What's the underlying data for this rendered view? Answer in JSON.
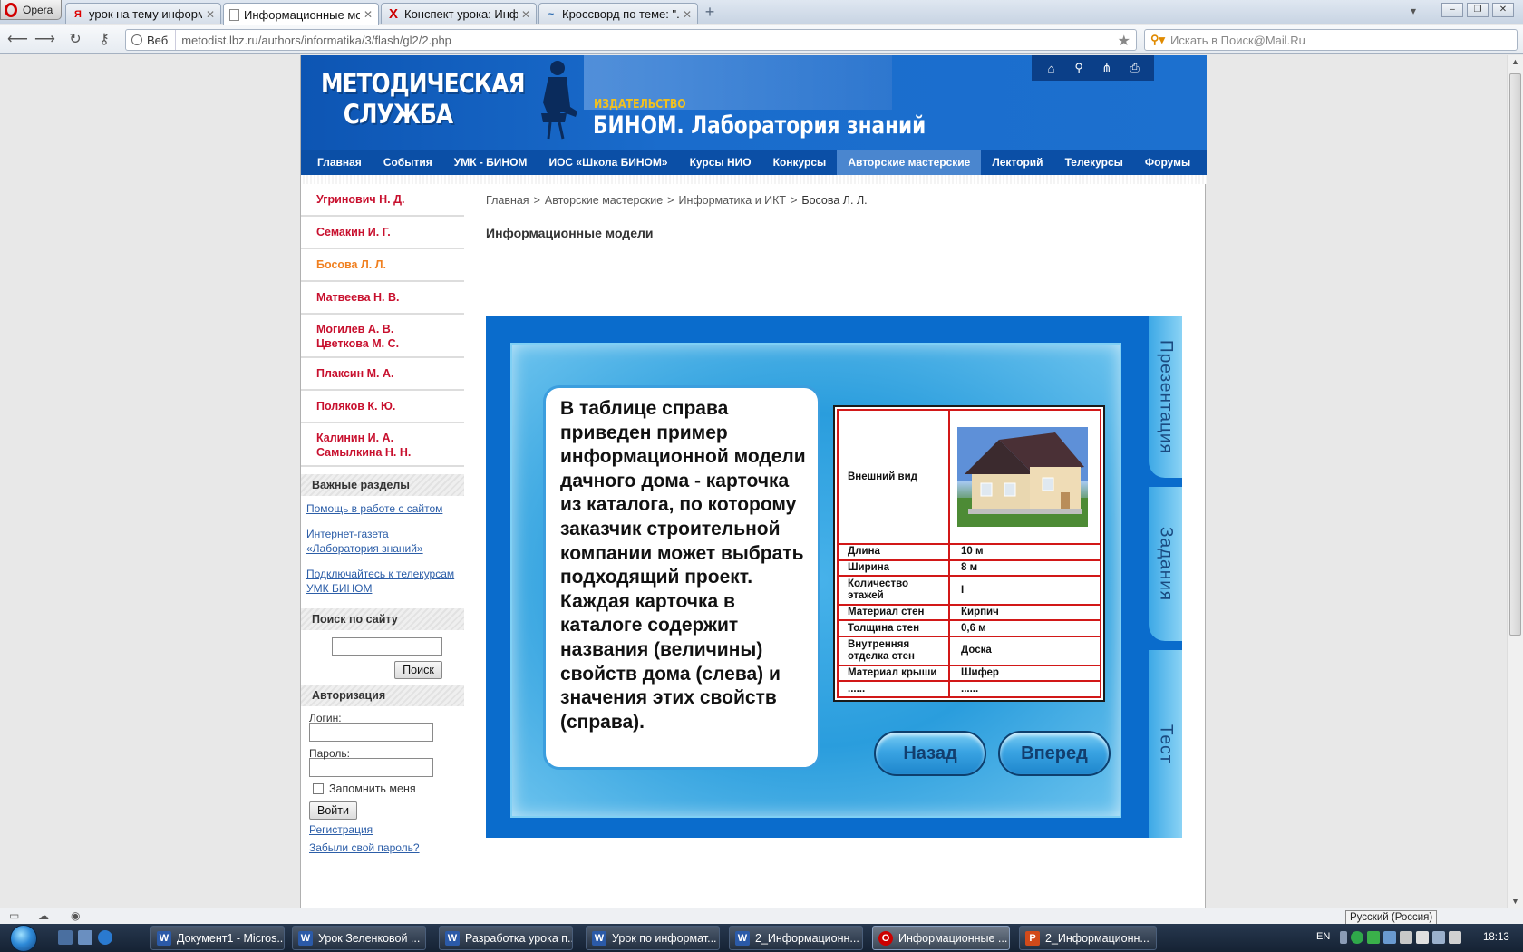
{
  "browser": {
    "menu_label": "Opera",
    "tabs": [
      {
        "label": "урок на тему информ...",
        "icon": "yandex-icon"
      },
      {
        "label": "Информационные мо...",
        "icon": "page-icon"
      },
      {
        "label": "Конспект урока: Инф...",
        "icon": "x-site-icon"
      },
      {
        "label": "Кроссворд по теме: \"...",
        "icon": "crossword-icon"
      }
    ],
    "url_prefix": "Веб",
    "url": "metodist.lbz.ru/authors/informatika/3/flash/gl2/2.php",
    "search_placeholder": "Искать в Поиск@Mail.Ru"
  },
  "header": {
    "logo_line1": "МЕТОДИЧЕСКАЯ",
    "logo_line2": "СЛУЖБА",
    "publisher_small": "ИЗДАТЕЛЬСТВО",
    "publisher_big": "БИНОМ. Лаборатория знаний",
    "icons": [
      "home-icon",
      "search-icon",
      "sitemap-icon",
      "print-icon"
    ]
  },
  "nav": {
    "items": [
      "Главная",
      "События",
      "УМК - БИНОМ",
      "ИОС «Школа БИНОМ»",
      "Курсы НИО",
      "Конкурсы",
      "Авторские мастерские",
      "Лекторий",
      "Телекурсы",
      "Форумы"
    ],
    "active_index": 6
  },
  "sidebar": {
    "authors": [
      {
        "line1": "Угринович Н. Д.",
        "line2": ""
      },
      {
        "line1": "Семакин И. Г.",
        "line2": ""
      },
      {
        "line1": "Босова Л. Л.",
        "line2": ""
      },
      {
        "line1": "Матвеева Н. В.",
        "line2": ""
      },
      {
        "line1": "Могилев А. В.",
        "line2": "Цветкова М. С."
      },
      {
        "line1": "Плаксин М. А.",
        "line2": ""
      },
      {
        "line1": "Поляков К. Ю.",
        "line2": ""
      },
      {
        "line1": "Калинин И. А.",
        "line2": "Самылкина Н. Н."
      }
    ],
    "important_title": "Важные разделы",
    "important_links": [
      "Помощь в работе с сайтом",
      "Интернет-газета «Лаборатория знаний»",
      "Подключайтесь к телекурсам УМК БИНОМ"
    ],
    "search_title": "Поиск по сайту",
    "search_button": "Поиск",
    "auth_title": "Авторизация",
    "login_label": "Логин:",
    "password_label": "Пароль:",
    "remember_label": "Запомнить меня",
    "login_button": "Войти",
    "register_link": "Регистрация",
    "forgot_link": "Забыли свой пароль?"
  },
  "content": {
    "breadcrumb": [
      "Главная",
      "Авторские мастерские",
      "Информатика и ИКТ",
      "Босова Л. Л."
    ],
    "breadcrumb_sep": ">",
    "title": "Информационные модели"
  },
  "flash": {
    "side_tabs": [
      "Презентация",
      "Задания",
      "Тест"
    ],
    "text": "В таблице справа приведен пример информационной модели дачного дома - карточка из каталога, по которому заказчик строительной компании может выбрать подходящий проект. Каждая карточка в каталоге содержит названия (величины) свойств дома (слева) и значения этих свойств (справа).",
    "table": {
      "image_label": "Внешний вид",
      "rows": [
        {
          "name": "Длина",
          "value": "10 м"
        },
        {
          "name": "Ширина",
          "value": "8 м"
        },
        {
          "name": "Количество этажей",
          "value": "I"
        },
        {
          "name": "Материал стен",
          "value": "Кирпич"
        },
        {
          "name": "Толщина стен",
          "value": "0,6 м"
        },
        {
          "name": "Внутренняя отделка стен",
          "value": "Доска"
        },
        {
          "name": "Материал крыши",
          "value": "Шифер"
        },
        {
          "name": "......",
          "value": "......"
        }
      ]
    },
    "back_button": "Назад",
    "forward_button": "Вперед"
  },
  "taskbar": {
    "buttons": [
      {
        "label": "Документ1 - Micros...",
        "icon": "W"
      },
      {
        "label": "Урок Зеленковой ...",
        "icon": "W"
      },
      {
        "label": "Разработка урока п...",
        "icon": "W"
      },
      {
        "label": "Урок по информат...",
        "icon": "W"
      },
      {
        "label": "2_Информационн...",
        "icon": "W"
      },
      {
        "label": "Информационные ...",
        "icon": "O"
      },
      {
        "label": "2_Информационн...",
        "icon": "P"
      }
    ],
    "lang": "EN",
    "lang_tooltip": "Русский (Россия)",
    "clock": "18:13"
  }
}
